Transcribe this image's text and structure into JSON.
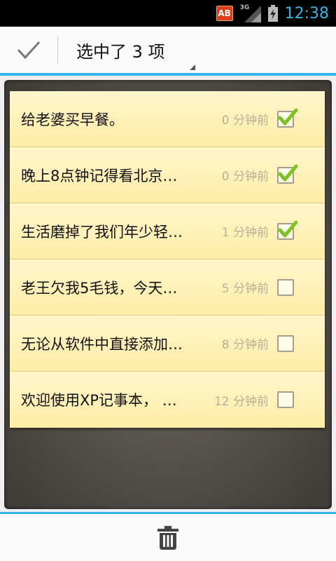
{
  "status_bar": {
    "app_badge": "AB",
    "network": "3G",
    "time": "12:38"
  },
  "action_bar": {
    "title": "选中了 3 项"
  },
  "notes": [
    {
      "text": "给老婆买早餐。",
      "time": "0 分钟前",
      "checked": true
    },
    {
      "text": "晚上8点钟记得看北京…",
      "time": "0 分钟前",
      "checked": true
    },
    {
      "text": "生活磨掉了我们年少轻…",
      "time": "1 分钟前",
      "checked": true
    },
    {
      "text": "老王欠我5毛钱，今天…",
      "time": "5 分钟前",
      "checked": false
    },
    {
      "text": "无论从软件中直接添加…",
      "time": "8 分钟前",
      "checked": false
    },
    {
      "text": "欢迎使用XP记事本， …",
      "time": "12 分钟前",
      "checked": false
    }
  ],
  "colors": {
    "accent": "#33b5e5",
    "note": "#fff0b0",
    "check": "#7dc21e"
  },
  "icons": {
    "done": "check-icon",
    "delete": "trash-icon"
  }
}
